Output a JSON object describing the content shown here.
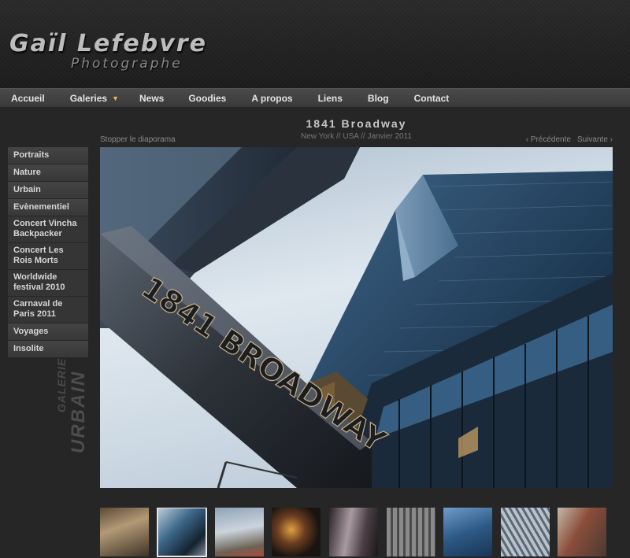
{
  "brand": {
    "name": "Gaïl Lefebvre",
    "subtitle": "Photographe"
  },
  "nav": {
    "items": [
      {
        "label": "Accueil"
      },
      {
        "label": "Galeries",
        "has_dropdown": true
      },
      {
        "label": "News"
      },
      {
        "label": "Goodies"
      },
      {
        "label": "A propos"
      },
      {
        "label": "Liens"
      },
      {
        "label": "Blog"
      },
      {
        "label": "Contact"
      }
    ]
  },
  "gallery": {
    "title": "1841 Broadway",
    "meta": "New York // USA // Janvier 2011",
    "stop_slideshow": "Stopper le diaporama",
    "prev": "‹ Précédente",
    "next": "Suivante ›",
    "vertical_label_small": "GALERIE",
    "vertical_label_big": "URBAIN"
  },
  "sidebar": {
    "items": [
      {
        "label": "Portraits",
        "type": "main"
      },
      {
        "label": "Nature",
        "type": "main"
      },
      {
        "label": "Urbain",
        "type": "main"
      },
      {
        "label": "Evènementiel",
        "type": "main"
      },
      {
        "label": "Concert Vincha Backpacker",
        "type": "sub"
      },
      {
        "label": "Concert Les Rois Morts",
        "type": "sub"
      },
      {
        "label": "Worldwide festival 2010",
        "type": "sub"
      },
      {
        "label": "Carnaval de Paris 2011",
        "type": "sub"
      },
      {
        "label": "Voyages",
        "type": "main"
      },
      {
        "label": "Insolite",
        "type": "main"
      }
    ]
  },
  "colors": {
    "background": "#262626",
    "nav_bar": "#404040",
    "accent_chevron": "#e8b84a",
    "sidebar_item": "#3b3b3b"
  },
  "photo": {
    "icon": "building-photo"
  },
  "thumbnails": {
    "count": 9,
    "active_index": 1
  }
}
